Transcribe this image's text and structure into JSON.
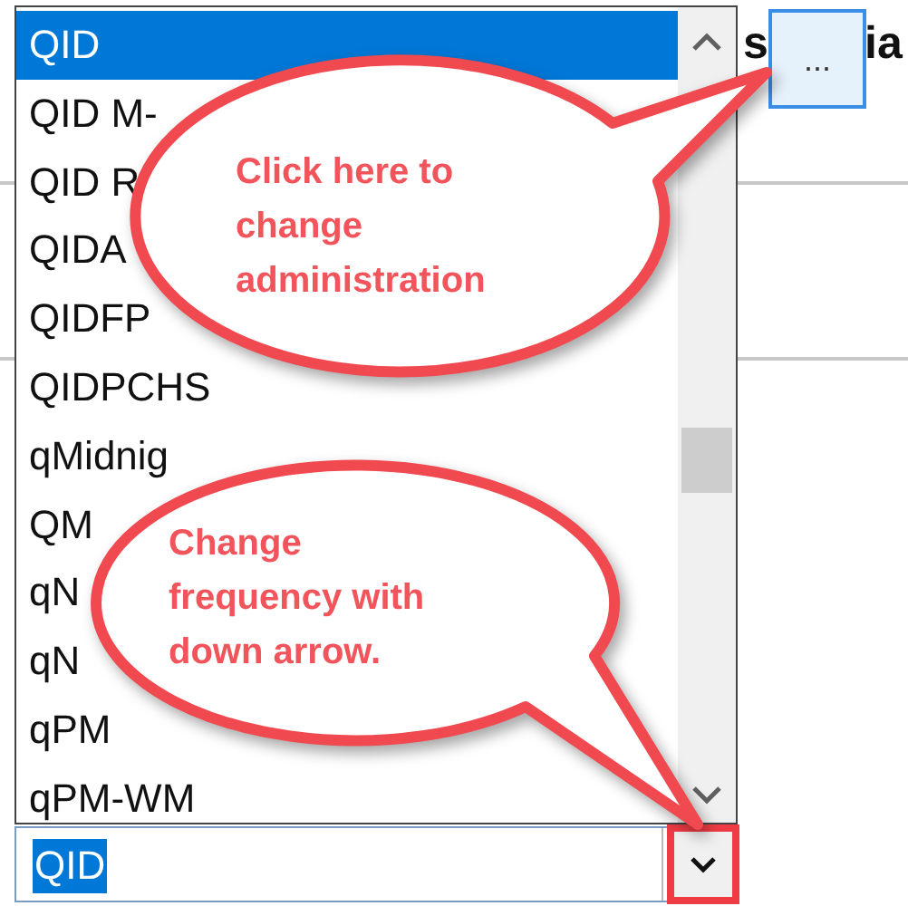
{
  "background": {
    "heading_fragments": [
      {
        "text": "s"
      },
      {
        "text": "ia"
      }
    ]
  },
  "ellipsis_button": {
    "label": "..."
  },
  "dropdown_list": {
    "items": [
      {
        "label": "QID",
        "selected": true
      },
      {
        "label": "QID M-",
        "selected": false
      },
      {
        "label": "QID R",
        "selected": false
      },
      {
        "label": "QIDA",
        "selected": false
      },
      {
        "label": "QIDFP",
        "selected": false
      },
      {
        "label": "QIDPCHS",
        "selected": false
      },
      {
        "label": "qMidnig",
        "selected": false
      },
      {
        "label": "QM",
        "selected": false
      },
      {
        "label": "qN",
        "selected": false
      },
      {
        "label": "qN",
        "selected": false
      },
      {
        "label": "qPM",
        "selected": false
      },
      {
        "label": "qPM-WM",
        "selected": false
      }
    ]
  },
  "combo": {
    "value": "QID"
  },
  "callouts": [
    {
      "lines": [
        "Click here to",
        "change",
        "administration"
      ]
    },
    {
      "lines": [
        "Change",
        "frequency with",
        "down arrow."
      ]
    }
  ]
}
